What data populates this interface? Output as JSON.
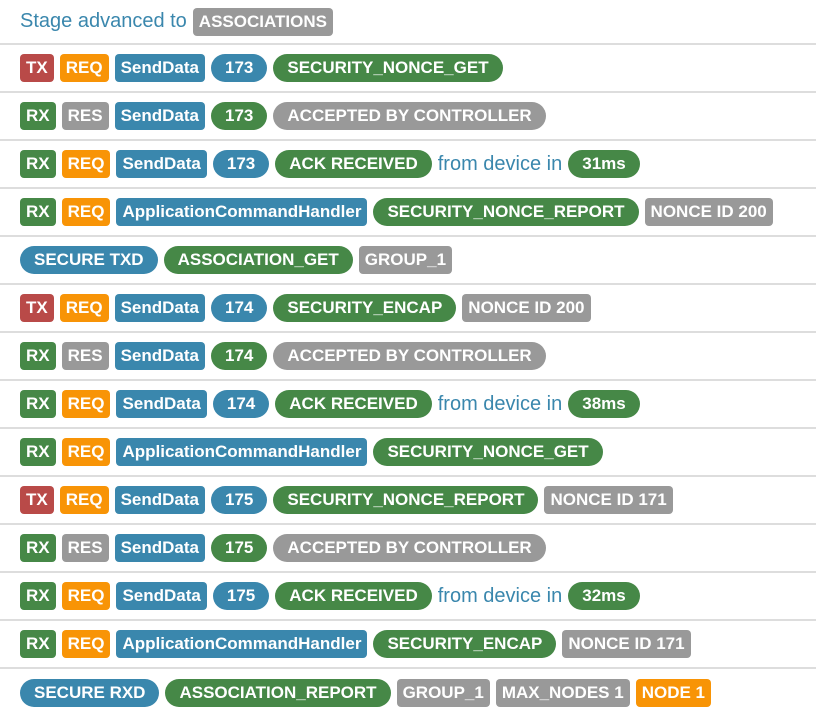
{
  "colors": {
    "red": "#b94a48",
    "orange": "#f89406",
    "blue": "#3a87ad",
    "green": "#468847",
    "gray": "#999999"
  },
  "rows": [
    [
      {
        "t": "Stage advanced to",
        "k": "text"
      },
      {
        "t": "ASSOCIATIONS",
        "c": "gray"
      }
    ],
    [
      {
        "t": "TX",
        "c": "red"
      },
      {
        "t": "REQ",
        "c": "orange"
      },
      {
        "t": "SendData",
        "c": "blue"
      },
      {
        "t": "173",
        "c": "blue",
        "p": 1
      },
      {
        "t": "SECURITY_NONCE_GET",
        "c": "green",
        "p": 1
      }
    ],
    [
      {
        "t": "RX",
        "c": "green"
      },
      {
        "t": "RES",
        "c": "gray"
      },
      {
        "t": "SendData",
        "c": "blue"
      },
      {
        "t": "173",
        "c": "green",
        "p": 1
      },
      {
        "t": "ACCEPTED BY CONTROLLER",
        "c": "gray",
        "p": 1
      }
    ],
    [
      {
        "t": "RX",
        "c": "green"
      },
      {
        "t": "REQ",
        "c": "orange"
      },
      {
        "t": "SendData",
        "c": "blue"
      },
      {
        "t": "173",
        "c": "blue",
        "p": 1
      },
      {
        "t": "ACK RECEIVED",
        "c": "green",
        "p": 1
      },
      {
        "t": "from device in",
        "k": "text"
      },
      {
        "t": "31ms",
        "c": "green",
        "p": 1
      }
    ],
    [
      {
        "t": "RX",
        "c": "green"
      },
      {
        "t": "REQ",
        "c": "orange"
      },
      {
        "t": "ApplicationCommandHandler",
        "c": "blue"
      },
      {
        "t": "SECURITY_NONCE_REPORT",
        "c": "green",
        "p": 1
      },
      {
        "t": "NONCE ID 200",
        "c": "gray"
      }
    ],
    [
      {
        "t": "SECURE TXD",
        "c": "blue",
        "p": 1
      },
      {
        "t": "ASSOCIATION_GET",
        "c": "green",
        "p": 1
      },
      {
        "t": "GROUP_1",
        "c": "gray"
      }
    ],
    [
      {
        "t": "TX",
        "c": "red"
      },
      {
        "t": "REQ",
        "c": "orange"
      },
      {
        "t": "SendData",
        "c": "blue"
      },
      {
        "t": "174",
        "c": "blue",
        "p": 1
      },
      {
        "t": "SECURITY_ENCAP",
        "c": "green",
        "p": 1
      },
      {
        "t": "NONCE ID 200",
        "c": "gray"
      }
    ],
    [
      {
        "t": "RX",
        "c": "green"
      },
      {
        "t": "RES",
        "c": "gray"
      },
      {
        "t": "SendData",
        "c": "blue"
      },
      {
        "t": "174",
        "c": "green",
        "p": 1
      },
      {
        "t": "ACCEPTED BY CONTROLLER",
        "c": "gray",
        "p": 1
      }
    ],
    [
      {
        "t": "RX",
        "c": "green"
      },
      {
        "t": "REQ",
        "c": "orange"
      },
      {
        "t": "SendData",
        "c": "blue"
      },
      {
        "t": "174",
        "c": "blue",
        "p": 1
      },
      {
        "t": "ACK RECEIVED",
        "c": "green",
        "p": 1
      },
      {
        "t": "from device in",
        "k": "text"
      },
      {
        "t": "38ms",
        "c": "green",
        "p": 1
      }
    ],
    [
      {
        "t": "RX",
        "c": "green"
      },
      {
        "t": "REQ",
        "c": "orange"
      },
      {
        "t": "ApplicationCommandHandler",
        "c": "blue"
      },
      {
        "t": "SECURITY_NONCE_GET",
        "c": "green",
        "p": 1
      }
    ],
    [
      {
        "t": "TX",
        "c": "red"
      },
      {
        "t": "REQ",
        "c": "orange"
      },
      {
        "t": "SendData",
        "c": "blue"
      },
      {
        "t": "175",
        "c": "blue",
        "p": 1
      },
      {
        "t": "SECURITY_NONCE_REPORT",
        "c": "green",
        "p": 1
      },
      {
        "t": "NONCE ID 171",
        "c": "gray"
      }
    ],
    [
      {
        "t": "RX",
        "c": "green"
      },
      {
        "t": "RES",
        "c": "gray"
      },
      {
        "t": "SendData",
        "c": "blue"
      },
      {
        "t": "175",
        "c": "green",
        "p": 1
      },
      {
        "t": "ACCEPTED BY CONTROLLER",
        "c": "gray",
        "p": 1
      }
    ],
    [
      {
        "t": "RX",
        "c": "green"
      },
      {
        "t": "REQ",
        "c": "orange"
      },
      {
        "t": "SendData",
        "c": "blue"
      },
      {
        "t": "175",
        "c": "blue",
        "p": 1
      },
      {
        "t": "ACK RECEIVED",
        "c": "green",
        "p": 1
      },
      {
        "t": "from device in",
        "k": "text"
      },
      {
        "t": "32ms",
        "c": "green",
        "p": 1
      }
    ],
    [
      {
        "t": "RX",
        "c": "green"
      },
      {
        "t": "REQ",
        "c": "orange"
      },
      {
        "t": "ApplicationCommandHandler",
        "c": "blue"
      },
      {
        "t": "SECURITY_ENCAP",
        "c": "green",
        "p": 1
      },
      {
        "t": "NONCE ID 171",
        "c": "gray"
      }
    ],
    [
      {
        "t": "SECURE RXD",
        "c": "blue",
        "p": 1
      },
      {
        "t": "ASSOCIATION_REPORT",
        "c": "green",
        "p": 1
      },
      {
        "t": "GROUP_1",
        "c": "gray"
      },
      {
        "t": "MAX_NODES 1",
        "c": "gray"
      },
      {
        "t": "NODE 1",
        "c": "orange"
      }
    ]
  ]
}
